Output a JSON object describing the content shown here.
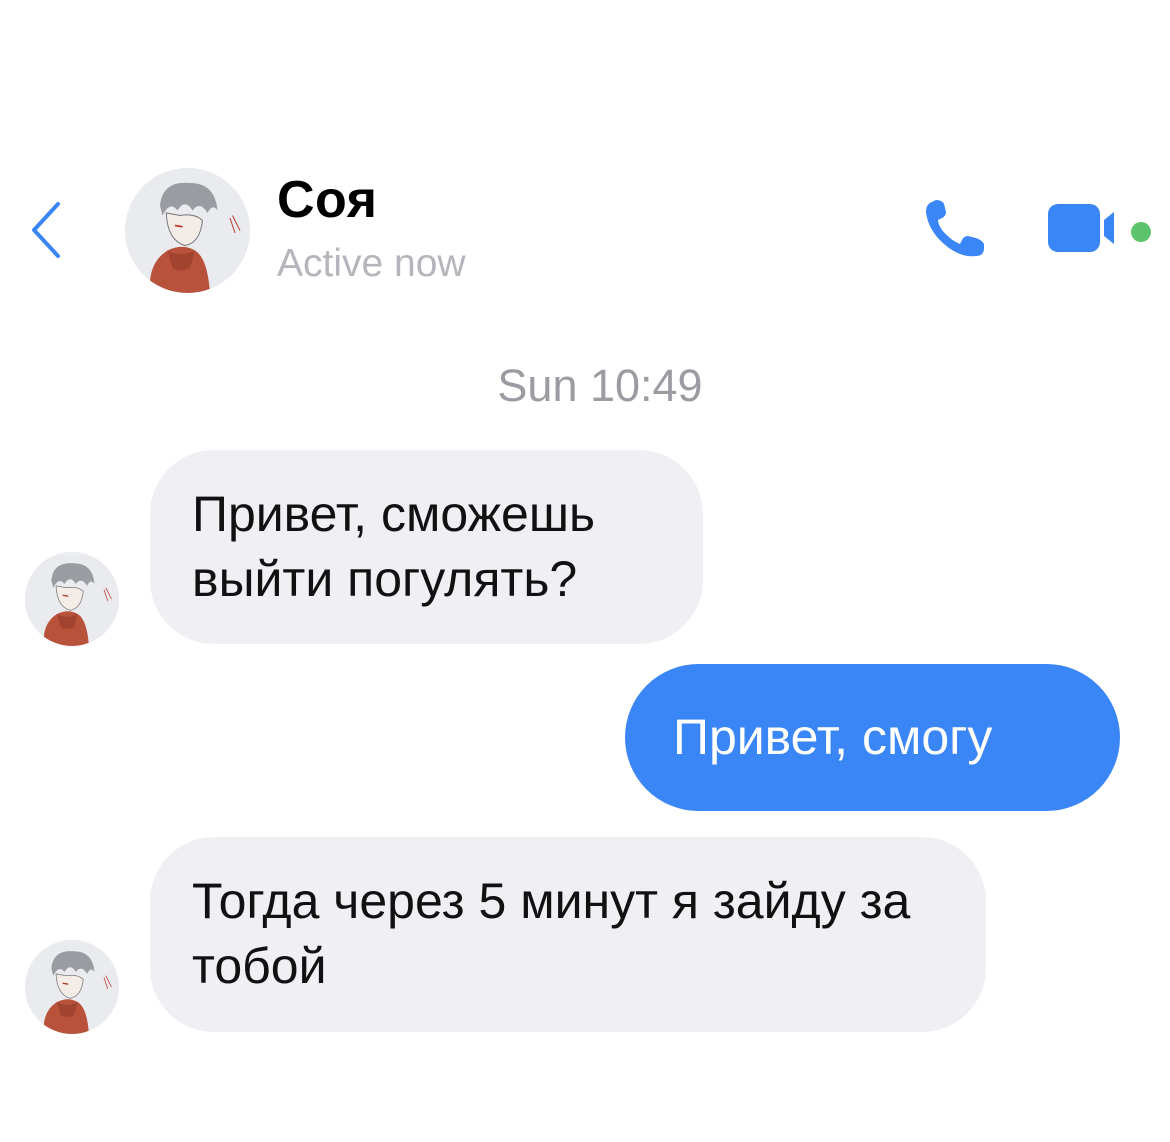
{
  "header": {
    "contact_name": "Соя",
    "status": "Active now",
    "accent_color": "#3b86f6",
    "online_color": "#5fc36b",
    "icons": {
      "back": "chevron-left-icon",
      "call": "phone-icon",
      "video": "video-camera-icon"
    }
  },
  "conversation": {
    "timestamp": "Sun 10:49",
    "messages": [
      {
        "direction": "incoming",
        "text": "Привет, сможешь выйти погулять?"
      },
      {
        "direction": "outgoing",
        "text": "Привет, смогу"
      },
      {
        "direction": "incoming",
        "text": "Тогда через 5 минут я зайду за тобой"
      }
    ]
  }
}
